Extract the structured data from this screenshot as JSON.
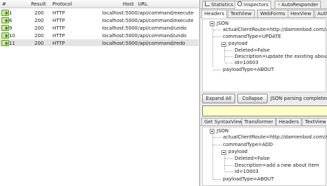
{
  "sessions": {
    "columns": [
      "#",
      "Result",
      "Protocol",
      "Host",
      "URL"
    ],
    "rows": [
      {
        "num": "1",
        "result": "200",
        "protocol": "HTTP",
        "host": "localhost:5000",
        "url": "/api/command/execute"
      },
      {
        "num": "6",
        "result": "200",
        "protocol": "HTTP",
        "host": "localhost:5000",
        "url": "/api/command/execute"
      },
      {
        "num": "9",
        "result": "200",
        "protocol": "HTTP",
        "host": "localhost:5000",
        "url": "/api/command/undo"
      },
      {
        "num": "10",
        "result": "200",
        "protocol": "HTTP",
        "host": "localhost:5000",
        "url": "/api/command/undo"
      },
      {
        "num": "11",
        "result": "200",
        "protocol": "HTTP",
        "host": "localhost:5000",
        "url": "/api/command/redo"
      }
    ]
  },
  "inspector": {
    "top_tabs": [
      "Statistics",
      "Inspectors",
      "AutoResponder"
    ],
    "request_tabs": [
      "Headers",
      "TextView",
      "WebForms",
      "HexView",
      "Auth"
    ],
    "request_tree": {
      "root": "JSON",
      "actualClientRoute": "actualClientRoute=http://damienbod.com/update",
      "commandType": "commandType=UPDATE",
      "payload": "payload",
      "deleted": "Deleted=False",
      "description": "Description=update the existing about item",
      "id": "Id=10003",
      "payloadType": "payloadType=ABOUT"
    },
    "expand_all": "Expand All",
    "collapse": "Collapse",
    "status": "JSON parsing completed",
    "response_tabs": [
      "Get SyntaxView",
      "Transformer",
      "Headers",
      "TextView"
    ],
    "response_tree": {
      "root": "JSON",
      "actualClientRoute": "actualClientRoute=http://damienbod.com/add",
      "commandType": "commandType=ADD",
      "payload": "payload",
      "deleted": "Deleted=False",
      "description": "Description=add a new about item",
      "id": "Id=10003",
      "payloadType": "payloadType=ABOUT"
    }
  },
  "colors": {
    "selected_row": "#e4e4e4",
    "highlight_bar": "#ffffc8",
    "icon_green": "#c6e89a"
  }
}
